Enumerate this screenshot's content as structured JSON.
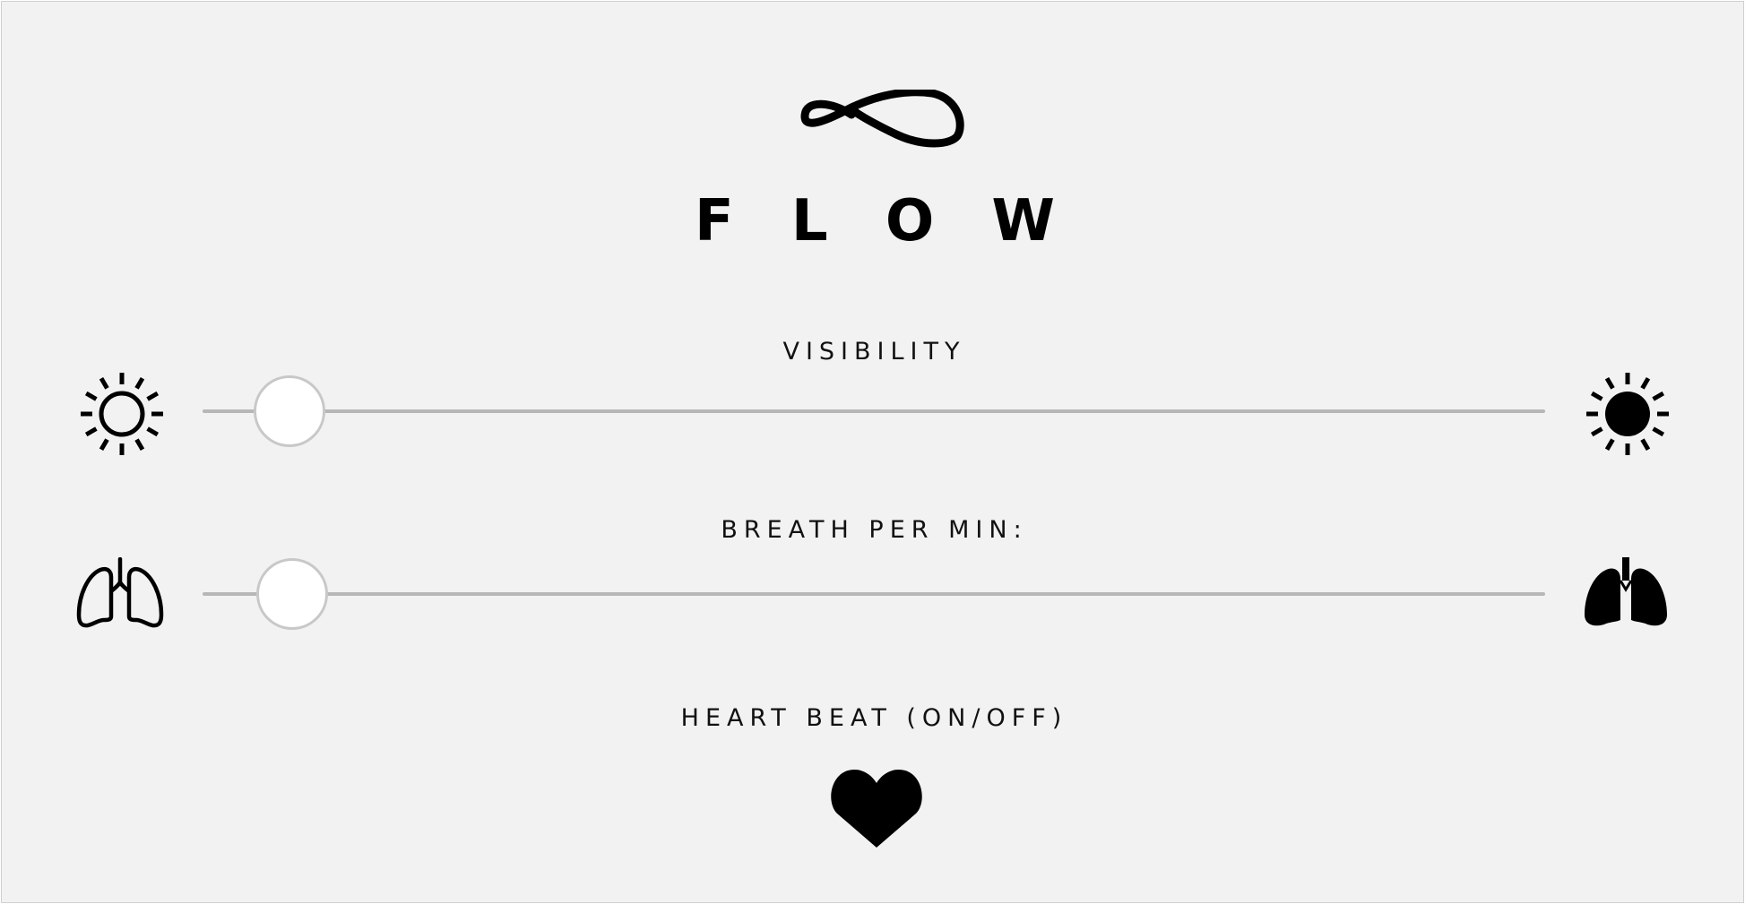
{
  "app": {
    "title_letters": [
      "F",
      "L",
      "O",
      "W"
    ],
    "logo_icon": "infinity-loop-icon"
  },
  "visibility": {
    "label": "VISIBILITY",
    "min_icon": "sun-outline-icon",
    "max_icon": "sun-filled-icon",
    "value_fraction": 0.065
  },
  "breath": {
    "label": "BREATH PER MIN:",
    "min_icon": "lungs-outline-icon",
    "max_icon": "lungs-filled-icon",
    "value_fraction": 0.067
  },
  "heartbeat": {
    "label": "HEART BEAT (ON/OFF)",
    "icon": "heart-filled-icon"
  },
  "colors": {
    "background": "#f2f2f2",
    "track": "#b7b7b7",
    "thumb_fill": "#ffffff",
    "thumb_border": "#c8c8c8",
    "ink": "#000000"
  }
}
